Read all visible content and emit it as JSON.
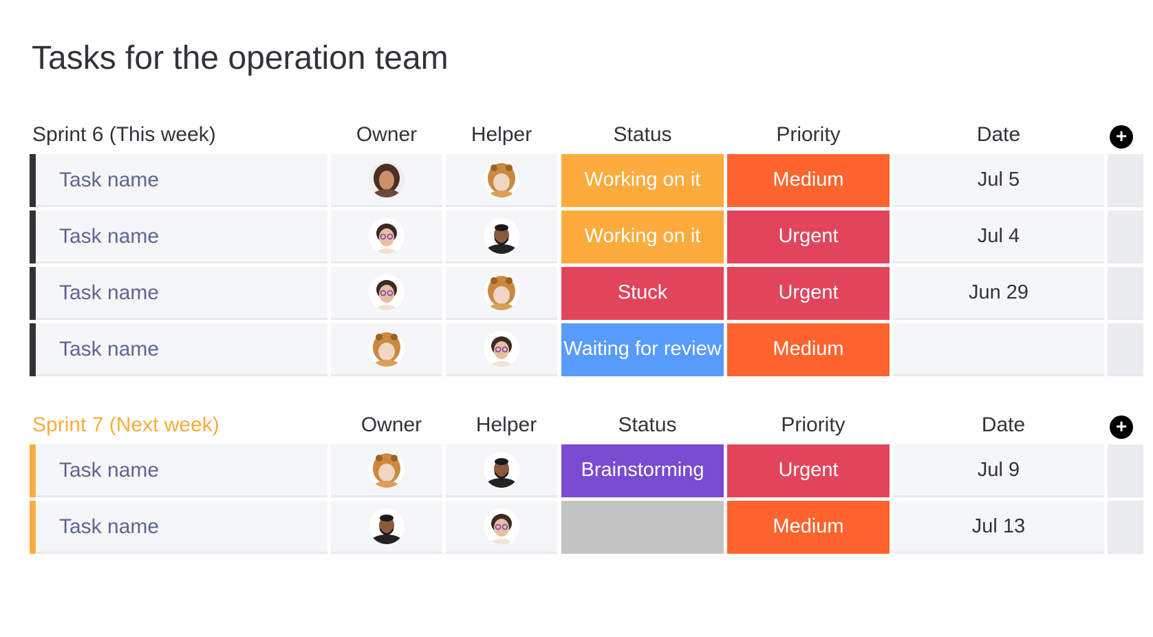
{
  "title": "Tasks for the operation team",
  "columns": {
    "owner": "Owner",
    "helper": "Helper",
    "status": "Status",
    "priority": "Priority",
    "date": "Date"
  },
  "colors": {
    "working": "#fdab3d",
    "stuck": "#e2445c",
    "waiting": "#579bfc",
    "brainstorming": "#784bd1",
    "empty_status": "#c4c4c4",
    "medium": "#ff642e",
    "urgent": "#e2445c",
    "sprint6_accent": "#333333",
    "sprint7_accent": "#fdab3d"
  },
  "groups": [
    {
      "title": "Sprint 6 (This week)",
      "title_color": "#323338",
      "bar_color": "#333333",
      "rows": [
        {
          "task": "Task name",
          "owner": "woman-curly-hair-avatar",
          "helper": "person-lion-hat-avatar",
          "status": "Working on it",
          "status_color": "#fdab3d",
          "priority": "Medium",
          "priority_color": "#ff642e",
          "date": "Jul 5"
        },
        {
          "task": "Task name",
          "owner": "woman-glasses-avatar",
          "helper": "man-beard-avatar",
          "status": "Working on it",
          "status_color": "#fdab3d",
          "priority": "Urgent",
          "priority_color": "#e2445c",
          "date": "Jul 4"
        },
        {
          "task": "Task name",
          "owner": "woman-glasses-avatar",
          "helper": "person-lion-hat-avatar",
          "status": "Stuck",
          "status_color": "#e2445c",
          "priority": "Urgent",
          "priority_color": "#e2445c",
          "date": "Jun 29"
        },
        {
          "task": "Task name",
          "owner": "person-lion-hat-avatar",
          "helper": "woman-glasses-avatar",
          "status": "Waiting for review",
          "status_color": "#579bfc",
          "priority": "Medium",
          "priority_color": "#ff642e",
          "date": ""
        }
      ]
    },
    {
      "title": "Sprint 7 (Next week)",
      "title_color": "#fdab3d",
      "bar_color": "#fdab3d",
      "rows": [
        {
          "task": "Task name",
          "owner": "person-lion-hat-avatar",
          "helper": "man-beard-avatar",
          "status": "Brainstorming",
          "status_color": "#784bd1",
          "priority": "Urgent",
          "priority_color": "#e2445c",
          "date": "Jul 9"
        },
        {
          "task": "Task name",
          "owner": "man-beard-avatar",
          "helper": "woman-glasses-avatar",
          "status": "",
          "status_color": "#c4c4c4",
          "priority": "Medium",
          "priority_color": "#ff642e",
          "date": "Jul 13"
        }
      ]
    }
  ],
  "add_icon": "plus-circle-icon"
}
